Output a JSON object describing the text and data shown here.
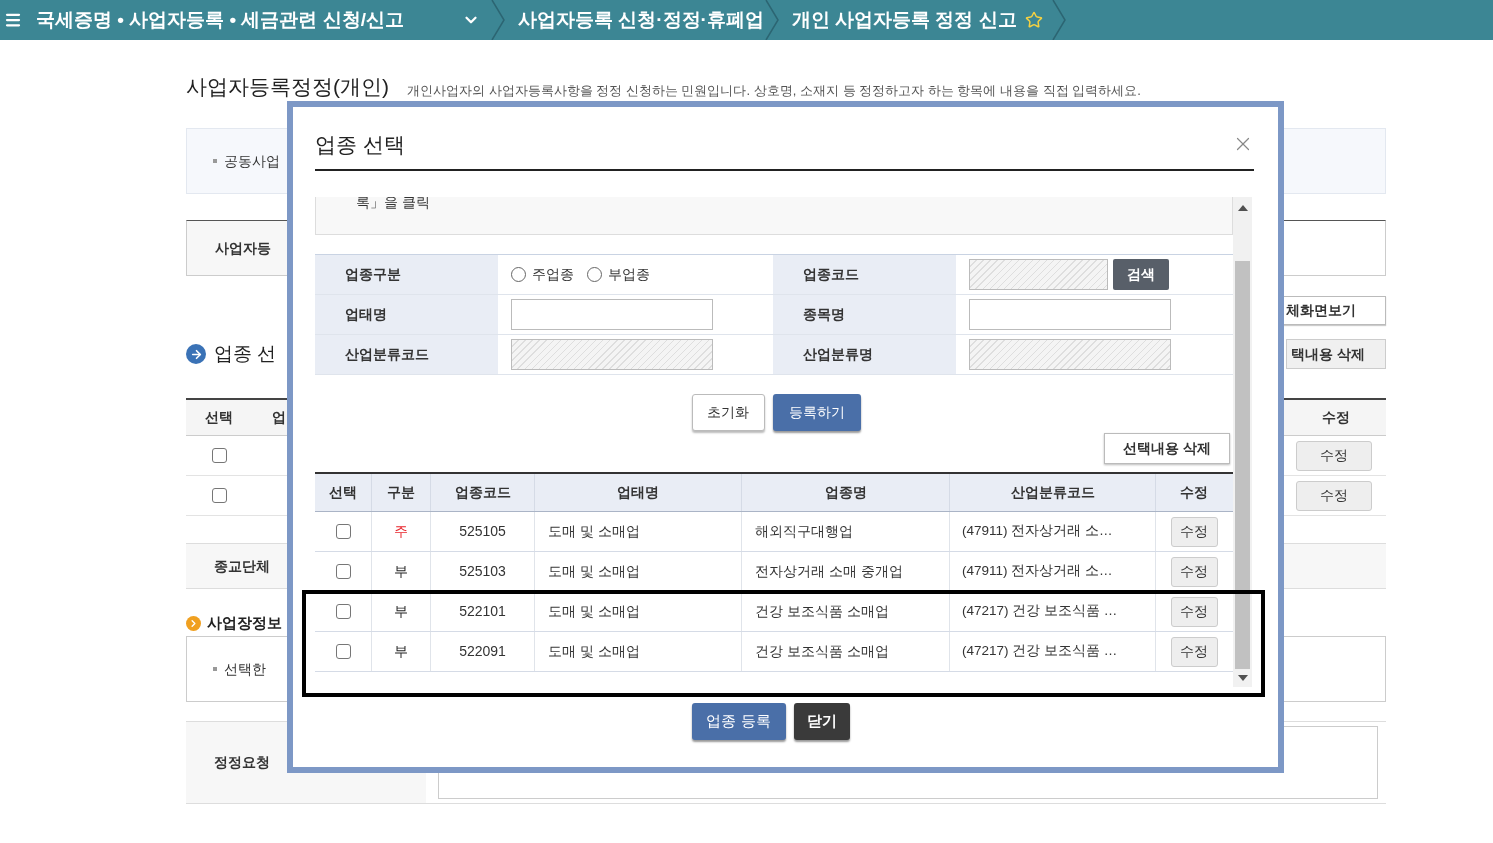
{
  "nav": {
    "breadcrumbs": [
      {
        "label": "국세증명 • 사업자등록 • 세금관련 신청/신고",
        "dropdown": true
      },
      {
        "label": "사업자등록 신청·정정·휴폐업",
        "dropdown": false
      },
      {
        "label": "개인 사업자등록 정정 신고",
        "dropdown": false
      }
    ],
    "favorite": false
  },
  "page": {
    "title": "사업자등록정정(개인)",
    "description": "개인사업자의 사업자등록사항을 정정 신청하는 민원입니다. 상호명, 소재지 등 정정하고자 하는 항목에 내용을 직접 입력하세요.",
    "notice": "공동사업",
    "row_label": "사업자등",
    "fullscreen_button": "체화면보기",
    "section_title": "업종 선",
    "delete_button": "택내용 삭제",
    "table": {
      "columns": [
        "선택",
        "업",
        "수정"
      ],
      "rows": [
        {
          "checked": false,
          "button": "수정"
        },
        {
          "checked": false,
          "button": "수정"
        }
      ]
    },
    "religion_label": "종교단체",
    "section2_title": "사업장정보",
    "notice2": "선택한",
    "request_label": "정정요청"
  },
  "modal": {
    "title": "업종 선택",
    "info_text": "록」을 클릭",
    "form": [
      [
        {
          "label": "업종구분",
          "kind": "radio",
          "options": [
            {
              "label": "주업종",
              "selected": false
            },
            {
              "label": "부업종",
              "selected": false
            }
          ]
        },
        {
          "label": "업종코드",
          "kind": "field",
          "disabled": true,
          "button": "검색"
        }
      ],
      [
        {
          "label": "업태명",
          "kind": "field",
          "disabled": false
        },
        {
          "label": "종목명",
          "kind": "field",
          "disabled": false
        }
      ],
      [
        {
          "label": "산업분류코드",
          "kind": "field",
          "disabled": true
        },
        {
          "label": "산업분류명",
          "kind": "field",
          "disabled": true
        }
      ]
    ],
    "reset_button": "초기화",
    "add_button": "등록하기",
    "delete_button": "선택내용 삭제",
    "table": {
      "columns": [
        "선택",
        "구분",
        "업종코드",
        "업태명",
        "업종명",
        "산업분류코드",
        "수정"
      ],
      "rows": [
        {
          "checked": false,
          "type": "주",
          "is_main": true,
          "code": "525105",
          "business": "도매 및 소매업",
          "item": "해외직구대행업",
          "industry": "(47911) 전자상거래 소…",
          "button": "수정"
        },
        {
          "checked": false,
          "type": "부",
          "is_main": false,
          "code": "525103",
          "business": "도매 및 소매업",
          "item": "전자상거래 소매 중개업",
          "industry": "(47911) 전자상거래 소…",
          "button": "수정"
        },
        {
          "checked": false,
          "type": "부",
          "is_main": false,
          "code": "522101",
          "business": "도매 및 소매업",
          "item": "건강 보조식품 소매업",
          "industry": "(47217) 건강 보조식품 …",
          "button": "수정"
        },
        {
          "checked": false,
          "type": "부",
          "is_main": false,
          "code": "522091",
          "business": "도매 및 소매업",
          "item": "건강 보조식품 소매업",
          "industry": "(47217) 건강 보조식품 …",
          "button": "수정"
        }
      ]
    },
    "register_button": "업종 등록",
    "close_button": "닫기"
  }
}
